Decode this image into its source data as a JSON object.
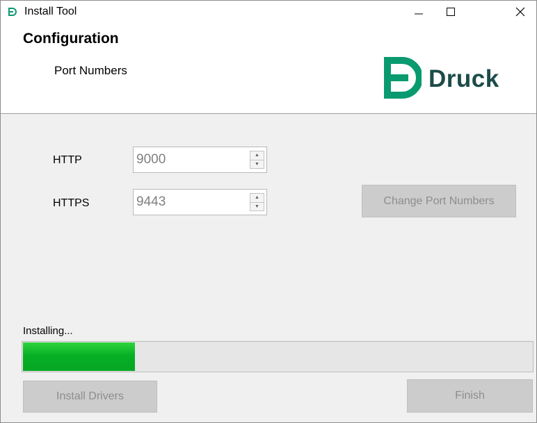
{
  "window": {
    "title": "Install Tool",
    "icon": "druck-app-icon",
    "controls": {
      "minimize": "minimize-icon",
      "maximize": "maximize-icon",
      "close": "close-icon"
    }
  },
  "header": {
    "title": "Configuration",
    "subtitle": "Port Numbers",
    "logo_text": "Druck",
    "logo_color": "#1c4c49",
    "logo_accent": "#0a9a70"
  },
  "ports": {
    "http": {
      "label": "HTTP",
      "value": "9000"
    },
    "https": {
      "label": "HTTPS",
      "value": "9443"
    }
  },
  "buttons": {
    "change_ports": "Change Port Numbers",
    "install_drivers": "Install Drivers",
    "finish": "Finish"
  },
  "status": {
    "text": "Installing...",
    "progress": 0.22,
    "bar_color": "#06b025"
  }
}
